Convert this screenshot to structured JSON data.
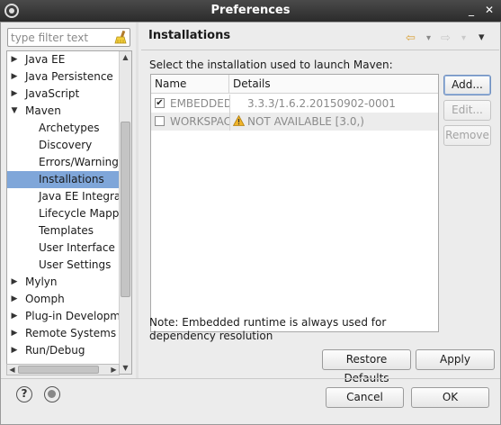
{
  "window": {
    "title": "Preferences",
    "minimize_glyph": "_",
    "close_glyph": "✕"
  },
  "filter": {
    "placeholder": "type filter text"
  },
  "tree": {
    "items": [
      {
        "label": "Java EE",
        "expander": "▶"
      },
      {
        "label": "Java Persistence",
        "expander": "▶"
      },
      {
        "label": "JavaScript",
        "expander": "▶"
      },
      {
        "label": "Maven",
        "expander": "▼"
      },
      {
        "label": "Archetypes"
      },
      {
        "label": "Discovery"
      },
      {
        "label": "Errors/Warnings"
      },
      {
        "label": "Installations"
      },
      {
        "label": "Java EE Integrati"
      },
      {
        "label": "Lifecycle Mappin"
      },
      {
        "label": "Templates"
      },
      {
        "label": "User Interface"
      },
      {
        "label": "User Settings"
      },
      {
        "label": "Mylyn",
        "expander": "▶"
      },
      {
        "label": "Oomph",
        "expander": "▶"
      },
      {
        "label": "Plug-in Developme",
        "expander": "▶"
      },
      {
        "label": "Remote Systems",
        "expander": "▶"
      },
      {
        "label": "Run/Debug",
        "expander": "▶"
      }
    ],
    "selected": "Installations",
    "scroll_up": "▲",
    "scroll_down": "▼",
    "scroll_left": "◀",
    "scroll_right": "▶"
  },
  "page": {
    "title": "Installations",
    "nav_back": "⇦",
    "nav_back_menu": "▾",
    "nav_forward": "⇨",
    "nav_forward_menu": "▾",
    "view_menu": "▾",
    "instruction": "Select the installation used to launch Maven:",
    "table": {
      "columns": [
        "Name",
        "Details"
      ],
      "rows": [
        {
          "checked": "✔",
          "name": "EMBEDDED",
          "details": "3.3.3/1.6.2.20150902-0001"
        },
        {
          "checked": "",
          "name": "WORKSPACE",
          "details": "NOT AVAILABLE [3.0,)"
        }
      ]
    },
    "buttons": {
      "add": "Add...",
      "edit": "Edit...",
      "remove": "Remove"
    },
    "note": "Note: Embedded runtime is always used for dependency resolution",
    "restore_defaults": "Restore Defaults",
    "apply": "Apply"
  },
  "footer": {
    "help_glyph": "?",
    "cancel": "Cancel",
    "ok": "OK"
  },
  "colors": {
    "selection": "#7fa6d9",
    "nav_arrow": "#e0a83a",
    "warning": "#f0b429"
  }
}
